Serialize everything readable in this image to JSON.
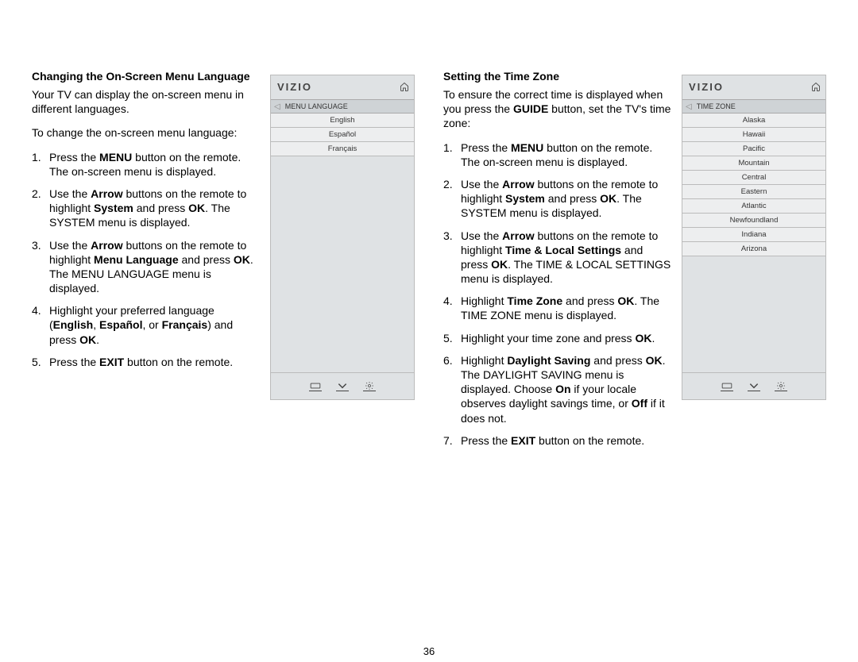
{
  "page_number": "36",
  "left": {
    "heading": "Changing the On-Screen Menu Language",
    "intro": "Your TV can display the on-screen menu in different languages.",
    "lead": "To change the on-screen menu language:",
    "steps": [
      [
        "Press the ",
        "MENU",
        " button on the remote. The on-screen menu is displayed."
      ],
      [
        "Use the ",
        "Arrow",
        " buttons on the remote to highlight ",
        "System",
        " and press ",
        "OK",
        ". The SYSTEM menu is displayed."
      ],
      [
        "Use the ",
        "Arrow",
        " buttons on the remote to highlight ",
        "Menu Language",
        " and press ",
        "OK",
        ". The MENU LANGUAGE menu is displayed."
      ],
      [
        "Highlight your preferred language (",
        "English",
        ", ",
        "Español",
        ", or ",
        "Français",
        ") and press ",
        "OK",
        "."
      ],
      [
        "Press the ",
        "EXIT",
        " button on the remote."
      ]
    ],
    "panel": {
      "brand": "VIZIO",
      "crumb": "MENU LANGUAGE",
      "options": [
        "English",
        "Español",
        "Français"
      ]
    }
  },
  "right": {
    "heading": "Setting the Time Zone",
    "intro_pre": "To ensure the correct time is displayed when you press the ",
    "intro_bold": "GUIDE",
    "intro_post": " button, set the TV's time zone:",
    "steps": [
      [
        "Press the ",
        "MENU",
        " button on the remote. The on-screen menu is displayed."
      ],
      [
        "Use the ",
        "Arrow",
        " buttons on the remote to highlight ",
        "System",
        " and press ",
        "OK",
        ". The SYSTEM menu is displayed."
      ],
      [
        "Use the ",
        "Arrow",
        " buttons on the remote to highlight ",
        "Time & Local Settings",
        " and press ",
        "OK",
        ". The TIME & LOCAL SETTINGS menu is displayed."
      ],
      [
        "Highlight ",
        "Time Zone",
        " and press ",
        "OK",
        ". The TIME ZONE menu is displayed."
      ],
      [
        "Highlight your time zone and press ",
        "OK",
        "."
      ],
      [
        "Highlight ",
        "Daylight Saving",
        " and press ",
        "OK",
        ". The DAYLIGHT SAVING menu is displayed. Choose ",
        "On",
        " if your locale observes daylight savings time, or ",
        "Off",
        " if it does not."
      ],
      [
        "Press the ",
        "EXIT",
        " button on the remote."
      ]
    ],
    "panel": {
      "brand": "VIZIO",
      "crumb": "TIME ZONE",
      "options": [
        "Alaska",
        "Hawaii",
        "Pacific",
        "Mountain",
        "Central",
        "Eastern",
        "Atlantic",
        "Newfoundland",
        "Indiana",
        "Arizona"
      ]
    }
  }
}
